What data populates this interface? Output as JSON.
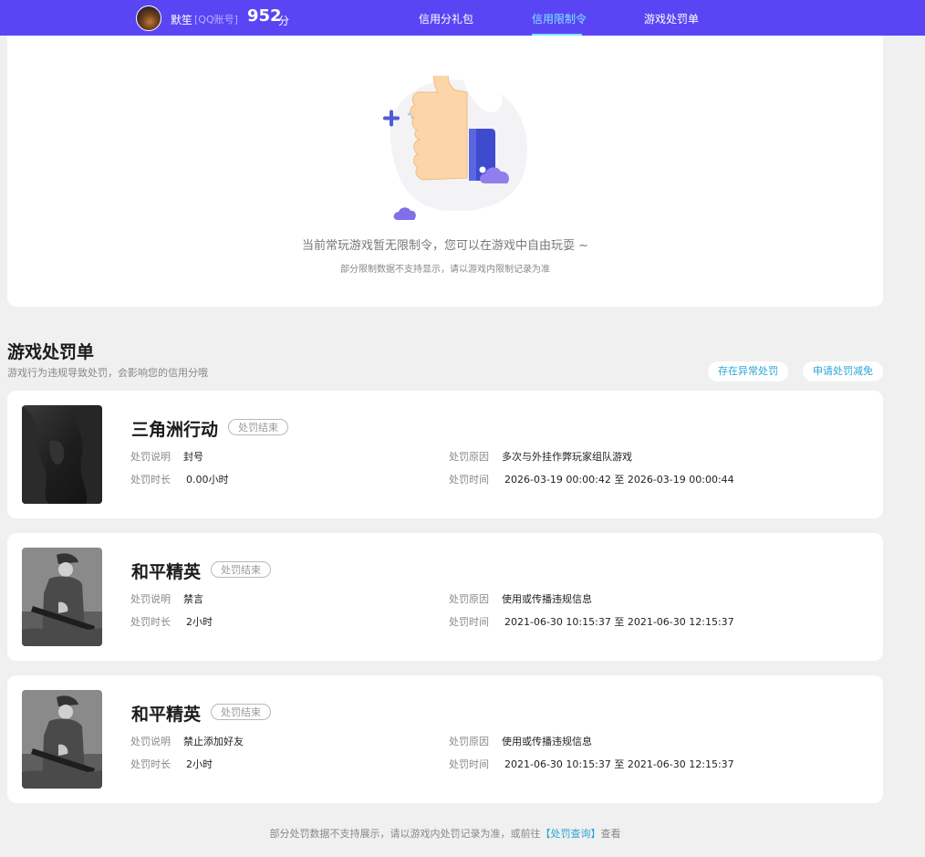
{
  "header": {
    "nickname": "默笙",
    "account_tag": "[QQ账号]",
    "score": "952",
    "score_unit": "分",
    "tabs": [
      {
        "label": "信用分礼包",
        "active": false
      },
      {
        "label": "信用限制令",
        "active": true
      },
      {
        "label": "游戏处罚单",
        "active": false
      }
    ],
    "colors": {
      "bar": "#5a45f5",
      "active_tab": "#7fe6ff"
    }
  },
  "restriction": {
    "illustration_icon": "thumbs-up-icon",
    "empty_text": "当前常玩游戏暂无限制令，您可以在游戏中自由玩耍 ~",
    "note": "部分限制数据不支持显示，请以游戏内限制记录为准"
  },
  "penalties": {
    "title": "游戏处罚单",
    "subtitle": "游戏行为违规导致处罚，会影响您的信用分哦",
    "abnormal_button": "存在异常处罚",
    "appeal_button": "申请处罚减免",
    "labels": {
      "desc": "处罚说明",
      "duration": "处罚时长",
      "reason": "处罚原因",
      "time": "处罚时间"
    },
    "items": [
      {
        "game": "三角洲行动",
        "status": "处罚结束",
        "desc": "封号",
        "duration": "0.00小时",
        "reason": "多次与外挂作弊玩家组队游戏",
        "time": "2026-03-19 00:00:42 至 2026-03-19 00:00:44"
      },
      {
        "game": "和平精英",
        "status": "处罚结束",
        "desc": "禁言",
        "duration": "2小时",
        "reason": "使用或传播违规信息",
        "time": "2021-06-30 10:15:37 至 2021-06-30 12:15:37"
      },
      {
        "game": "和平精英",
        "status": "处罚结束",
        "desc": "禁止添加好友",
        "duration": "2小时",
        "reason": "使用或传播违规信息",
        "time": "2021-06-30 10:15:37 至 2021-06-30 12:15:37"
      }
    ]
  },
  "footer": {
    "prefix": "部分处罚数据不支持展示，请以游戏内处罚记录为准，或前往",
    "link": "【处罚查询】",
    "suffix": "查看"
  }
}
